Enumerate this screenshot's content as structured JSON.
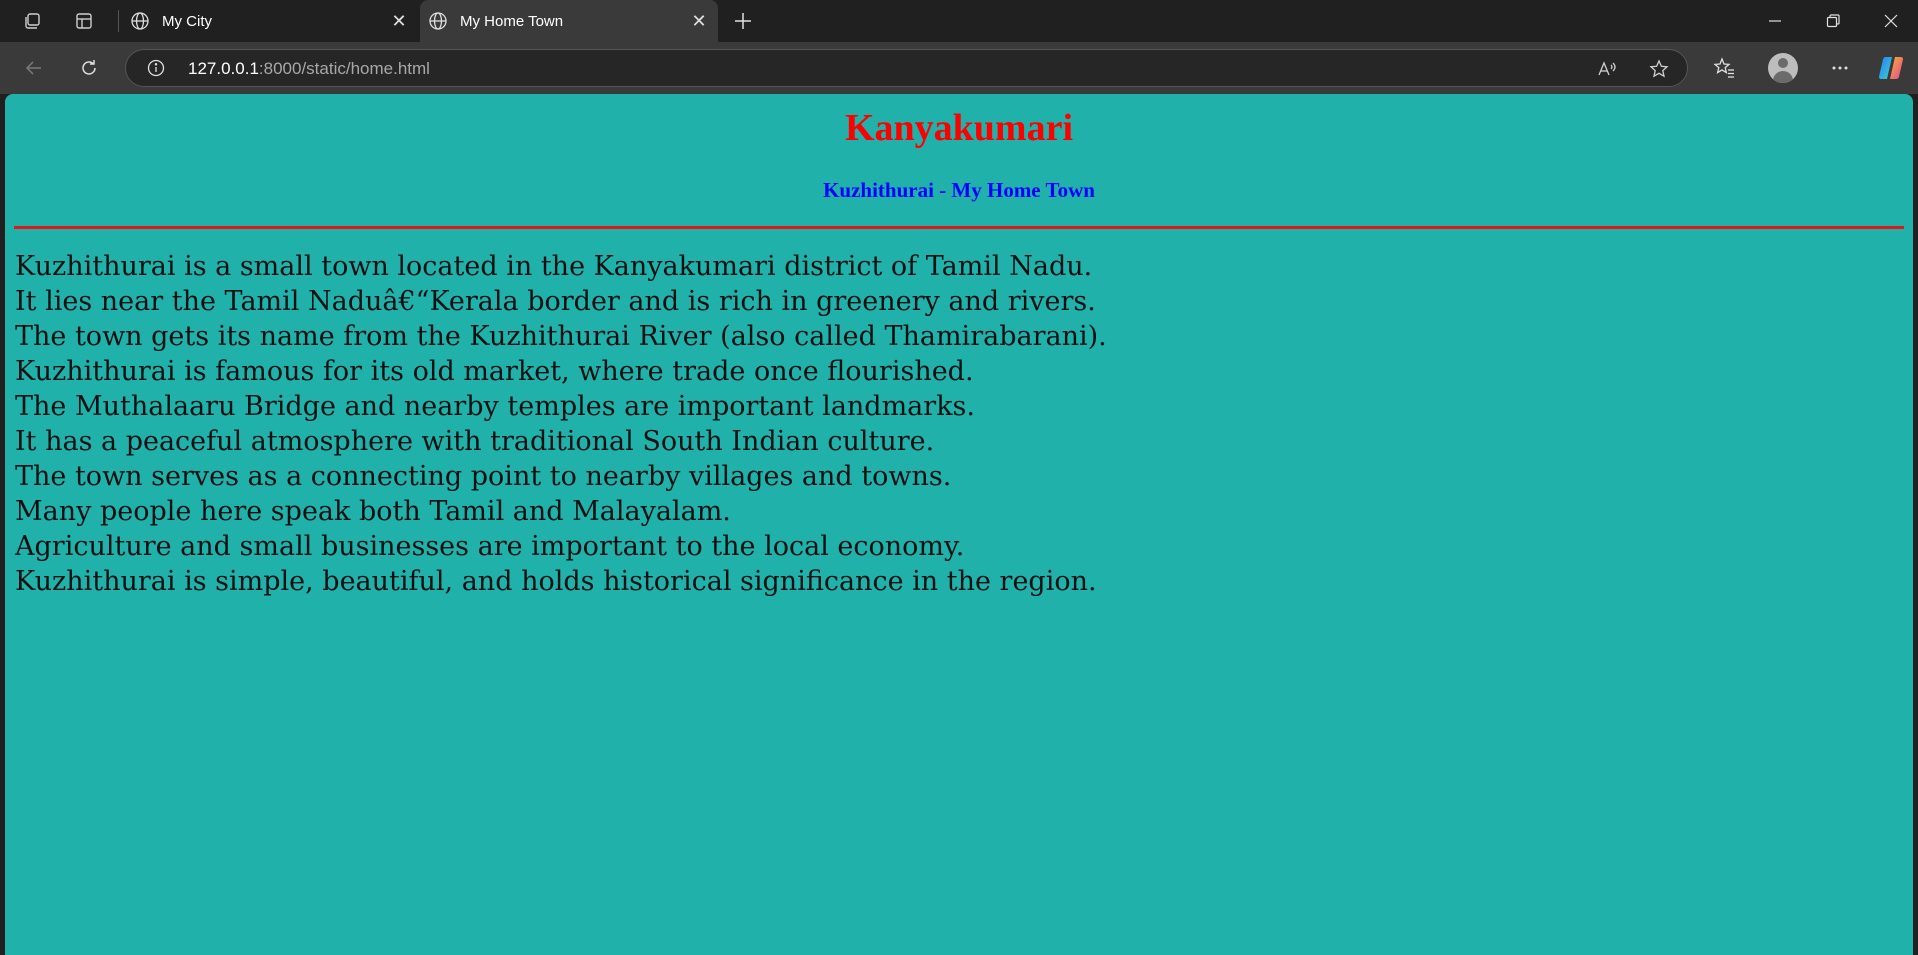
{
  "browser": {
    "tabs": [
      {
        "title": "My City",
        "active": false
      },
      {
        "title": "My Home Town",
        "active": true
      }
    ],
    "address": {
      "host": "127.0.0.1",
      "path": ":8000/static/home.html"
    }
  },
  "page": {
    "title": "Kanyakumari",
    "subtitle": "Kuzhithurai - My Home Town",
    "background_color": "#20b2aa",
    "title_color": "#ff0000",
    "subtitle_color": "#0000ff",
    "rule_color": "#e01818",
    "lines": [
      "Kuzhithurai is a small town located in the Kanyakumari district of Tamil Nadu.",
      "It lies near the Tamil Naduâ€“Kerala border and is rich in greenery and rivers.",
      "The town gets its name from the Kuzhithurai River (also called Thamirabarani).",
      "Kuzhithurai is famous for its old market, where trade once flourished.",
      "The Muthalaaru Bridge and nearby temples are important landmarks.",
      "It has a peaceful atmosphere with traditional South Indian culture.",
      "The town serves as a connecting point to nearby villages and towns.",
      "Many people here speak both Tamil and Malayalam.",
      "Agriculture and small businesses are important to the local economy.",
      "Kuzhithurai is simple, beautiful, and holds historical significance in the region."
    ]
  }
}
